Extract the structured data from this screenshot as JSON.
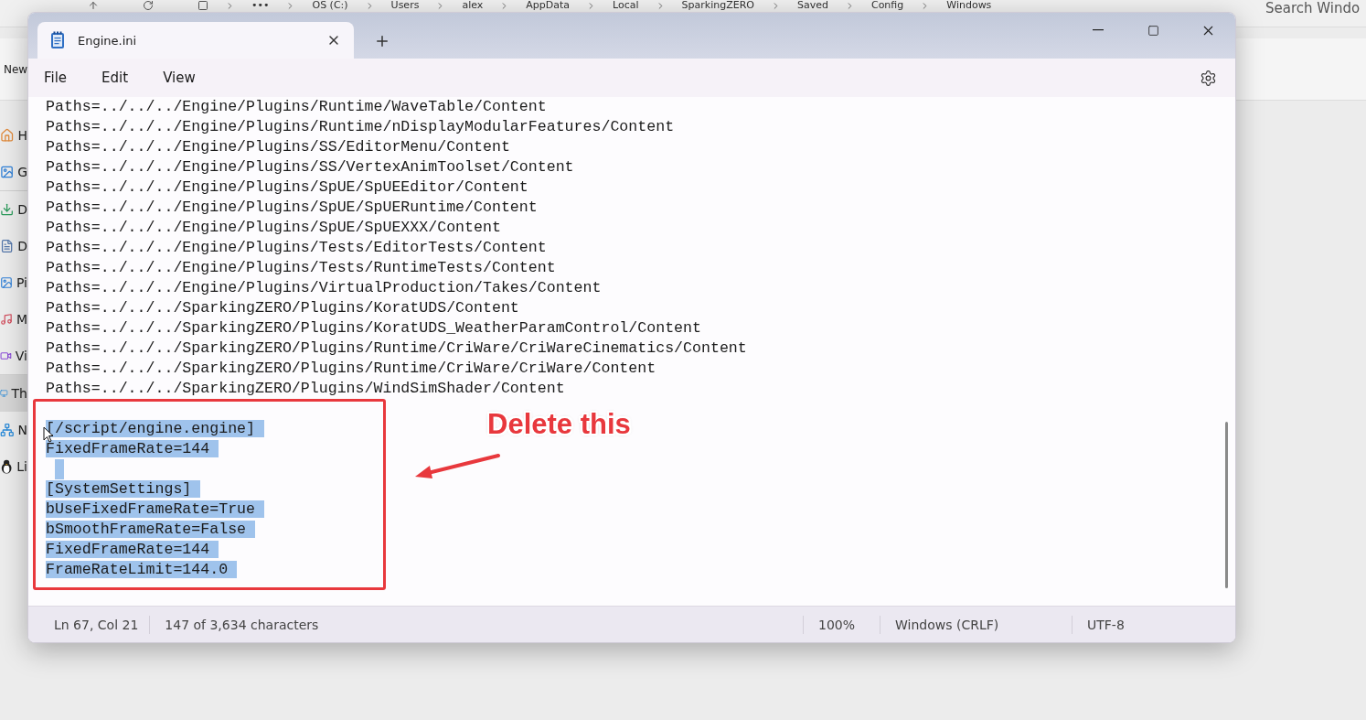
{
  "explorer": {
    "breadcrumb": [
      "•••",
      "OS (C:)",
      "Users",
      "alex",
      "AppData",
      "Local",
      "SparkingZERO",
      "Saved",
      "Config",
      "Windows"
    ],
    "search": {
      "placeholder": "Search Windo"
    },
    "toolbar": [
      "New"
    ],
    "sidebar": {
      "items": [
        {
          "label": "H",
          "selected": false
        },
        {
          "label": "G",
          "selected": false
        },
        {
          "label": "D",
          "selected": false
        },
        {
          "label": "D",
          "selected": false
        },
        {
          "label": "Pi",
          "selected": false
        },
        {
          "label": "M",
          "selected": false
        },
        {
          "label": "Vi",
          "selected": false
        },
        {
          "label": "Th",
          "selected": true
        },
        {
          "label": "N",
          "selected": false
        },
        {
          "label": "Li",
          "selected": false
        }
      ]
    }
  },
  "notepad": {
    "tabs": [
      {
        "title": "Engine.ini",
        "selected": true
      }
    ],
    "menu": [
      "File",
      "Edit",
      "View"
    ],
    "lines": [
      {
        "text": "Paths=../../../Engine/Plugins/Runtime/WaveTable/Content",
        "selected": false
      },
      {
        "text": "Paths=../../../Engine/Plugins/Runtime/nDisplayModularFeatures/Content",
        "selected": false
      },
      {
        "text": "Paths=../../../Engine/Plugins/SS/EditorMenu/Content",
        "selected": false
      },
      {
        "text": "Paths=../../../Engine/Plugins/SS/VertexAnimToolset/Content",
        "selected": false
      },
      {
        "text": "Paths=../../../Engine/Plugins/SpUE/SpUEEditor/Content",
        "selected": false
      },
      {
        "text": "Paths=../../../Engine/Plugins/SpUE/SpUERuntime/Content",
        "selected": false
      },
      {
        "text": "Paths=../../../Engine/Plugins/SpUE/SpUEXXX/Content",
        "selected": false
      },
      {
        "text": "Paths=../../../Engine/Plugins/Tests/EditorTests/Content",
        "selected": false
      },
      {
        "text": "Paths=../../../Engine/Plugins/Tests/RuntimeTests/Content",
        "selected": false
      },
      {
        "text": "Paths=../../../Engine/Plugins/VirtualProduction/Takes/Content",
        "selected": false
      },
      {
        "text": "Paths=../../../SparkingZERO/Plugins/KoratUDS/Content",
        "selected": false
      },
      {
        "text": "Paths=../../../SparkingZERO/Plugins/KoratUDS_WeatherParamControl/Content",
        "selected": false
      },
      {
        "text": "Paths=../../../SparkingZERO/Plugins/Runtime/CriWare/CriWareCinematics/Content",
        "selected": false
      },
      {
        "text": "Paths=../../../SparkingZERO/Plugins/Runtime/CriWare/CriWare/Content",
        "selected": false
      },
      {
        "text": "Paths=../../../SparkingZERO/Plugins/WindSimShader/Content",
        "selected": false
      },
      {
        "selected": false
      },
      {
        "text": "[/script/engine.engine]",
        "selected": true
      },
      {
        "text": "FixedFrameRate=144",
        "selected": true
      },
      {
        "selected": true
      },
      {
        "text": "[SystemSettings]",
        "selected": true
      },
      {
        "text": "bUseFixedFrameRate=True",
        "selected": true
      },
      {
        "text": "bSmoothFrameRate=False",
        "selected": true
      },
      {
        "text": "FixedFrameRate=144",
        "selected": true
      },
      {
        "text": "FrameRateLimit=144.0",
        "selected": true
      }
    ],
    "status_bar": {
      "position": "Ln 67, Col 21",
      "selection": "147 of 3,634 characters",
      "zoom": "100%",
      "line_ending": "Windows (CRLF)",
      "encoding": "UTF-8"
    }
  },
  "annotation": {
    "label": "Delete this"
  }
}
